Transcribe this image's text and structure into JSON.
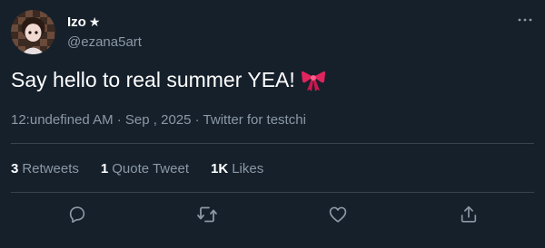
{
  "tweet": {
    "author": {
      "display_name": "Izo",
      "badge_icon": "star-icon",
      "badge_glyph": "★",
      "handle": "@ezana5art"
    },
    "text": "Say hello to real summer YEA!",
    "emoji_icon": "ribbon-icon",
    "meta": "12:undefined AM · Sep , 2025 · Twitter for testchi",
    "stats": {
      "retweets": {
        "count": "3",
        "label": "Retweets"
      },
      "quote_tweets": {
        "count": "1",
        "label": "Quote Tweet"
      },
      "likes": {
        "count": "1K",
        "label": "Likes"
      }
    },
    "actions": [
      "reply-icon",
      "retweet-icon",
      "like-icon",
      "share-icon"
    ]
  },
  "theme": {
    "background": "#15202b",
    "text_primary": "#ffffff",
    "text_secondary": "#8b98a5",
    "divider": "#38444d",
    "ribbon": "#e0245e"
  }
}
